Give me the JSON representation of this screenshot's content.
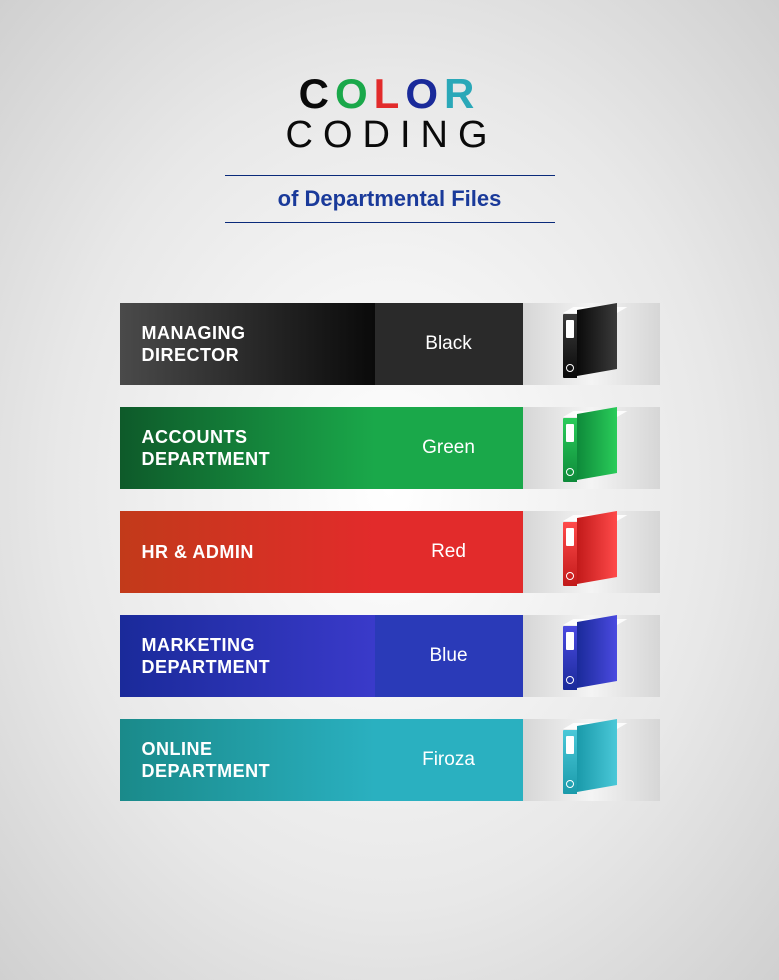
{
  "header": {
    "title_letters": [
      {
        "char": "C",
        "color": "#0a0a0a"
      },
      {
        "char": "O",
        "color": "#1aa84a"
      },
      {
        "char": "L",
        "color": "#e22b2b"
      },
      {
        "char": "O",
        "color": "#1a2a9a"
      },
      {
        "char": "R",
        "color": "#2aa8b8"
      }
    ],
    "title_line2": "CODING",
    "subtitle": "of Departmental Files"
  },
  "rows": [
    {
      "dept": "MANAGING\nDIRECTOR",
      "color_label": "Black",
      "gradient_from": "#4a4a4a",
      "gradient_to": "#0a0a0a",
      "solid": "#2a2a2a",
      "binder": "#0a0a0a",
      "binder_light": "#3a3a3a"
    },
    {
      "dept": "ACCOUNTS\nDEPARTMENT",
      "color_label": "Green",
      "gradient_from": "#0e5a2a",
      "gradient_to": "#1aa84a",
      "solid": "#1aa84a",
      "binder": "#0e8a3a",
      "binder_light": "#2acc5a"
    },
    {
      "dept": "HR & ADMIN",
      "color_label": "Red",
      "gradient_from": "#c23a1a",
      "gradient_to": "#e22b2b",
      "solid": "#e22b2b",
      "binder": "#c21a1a",
      "binder_light": "#ff4a4a"
    },
    {
      "dept": "MARKETING\nDEPARTMENT",
      "color_label": "Blue",
      "gradient_from": "#1a2a9a",
      "gradient_to": "#3a3aca",
      "solid": "#2a3ab8",
      "binder": "#1a2a9a",
      "binder_light": "#4a4ae0"
    },
    {
      "dept": "ONLINE\nDEPARTMENT",
      "color_label": "Firoza",
      "gradient_from": "#1a8a8a",
      "gradient_to": "#2ab0c0",
      "solid": "#2ab0c0",
      "binder": "#1a9aaa",
      "binder_light": "#4ac8d8"
    }
  ]
}
